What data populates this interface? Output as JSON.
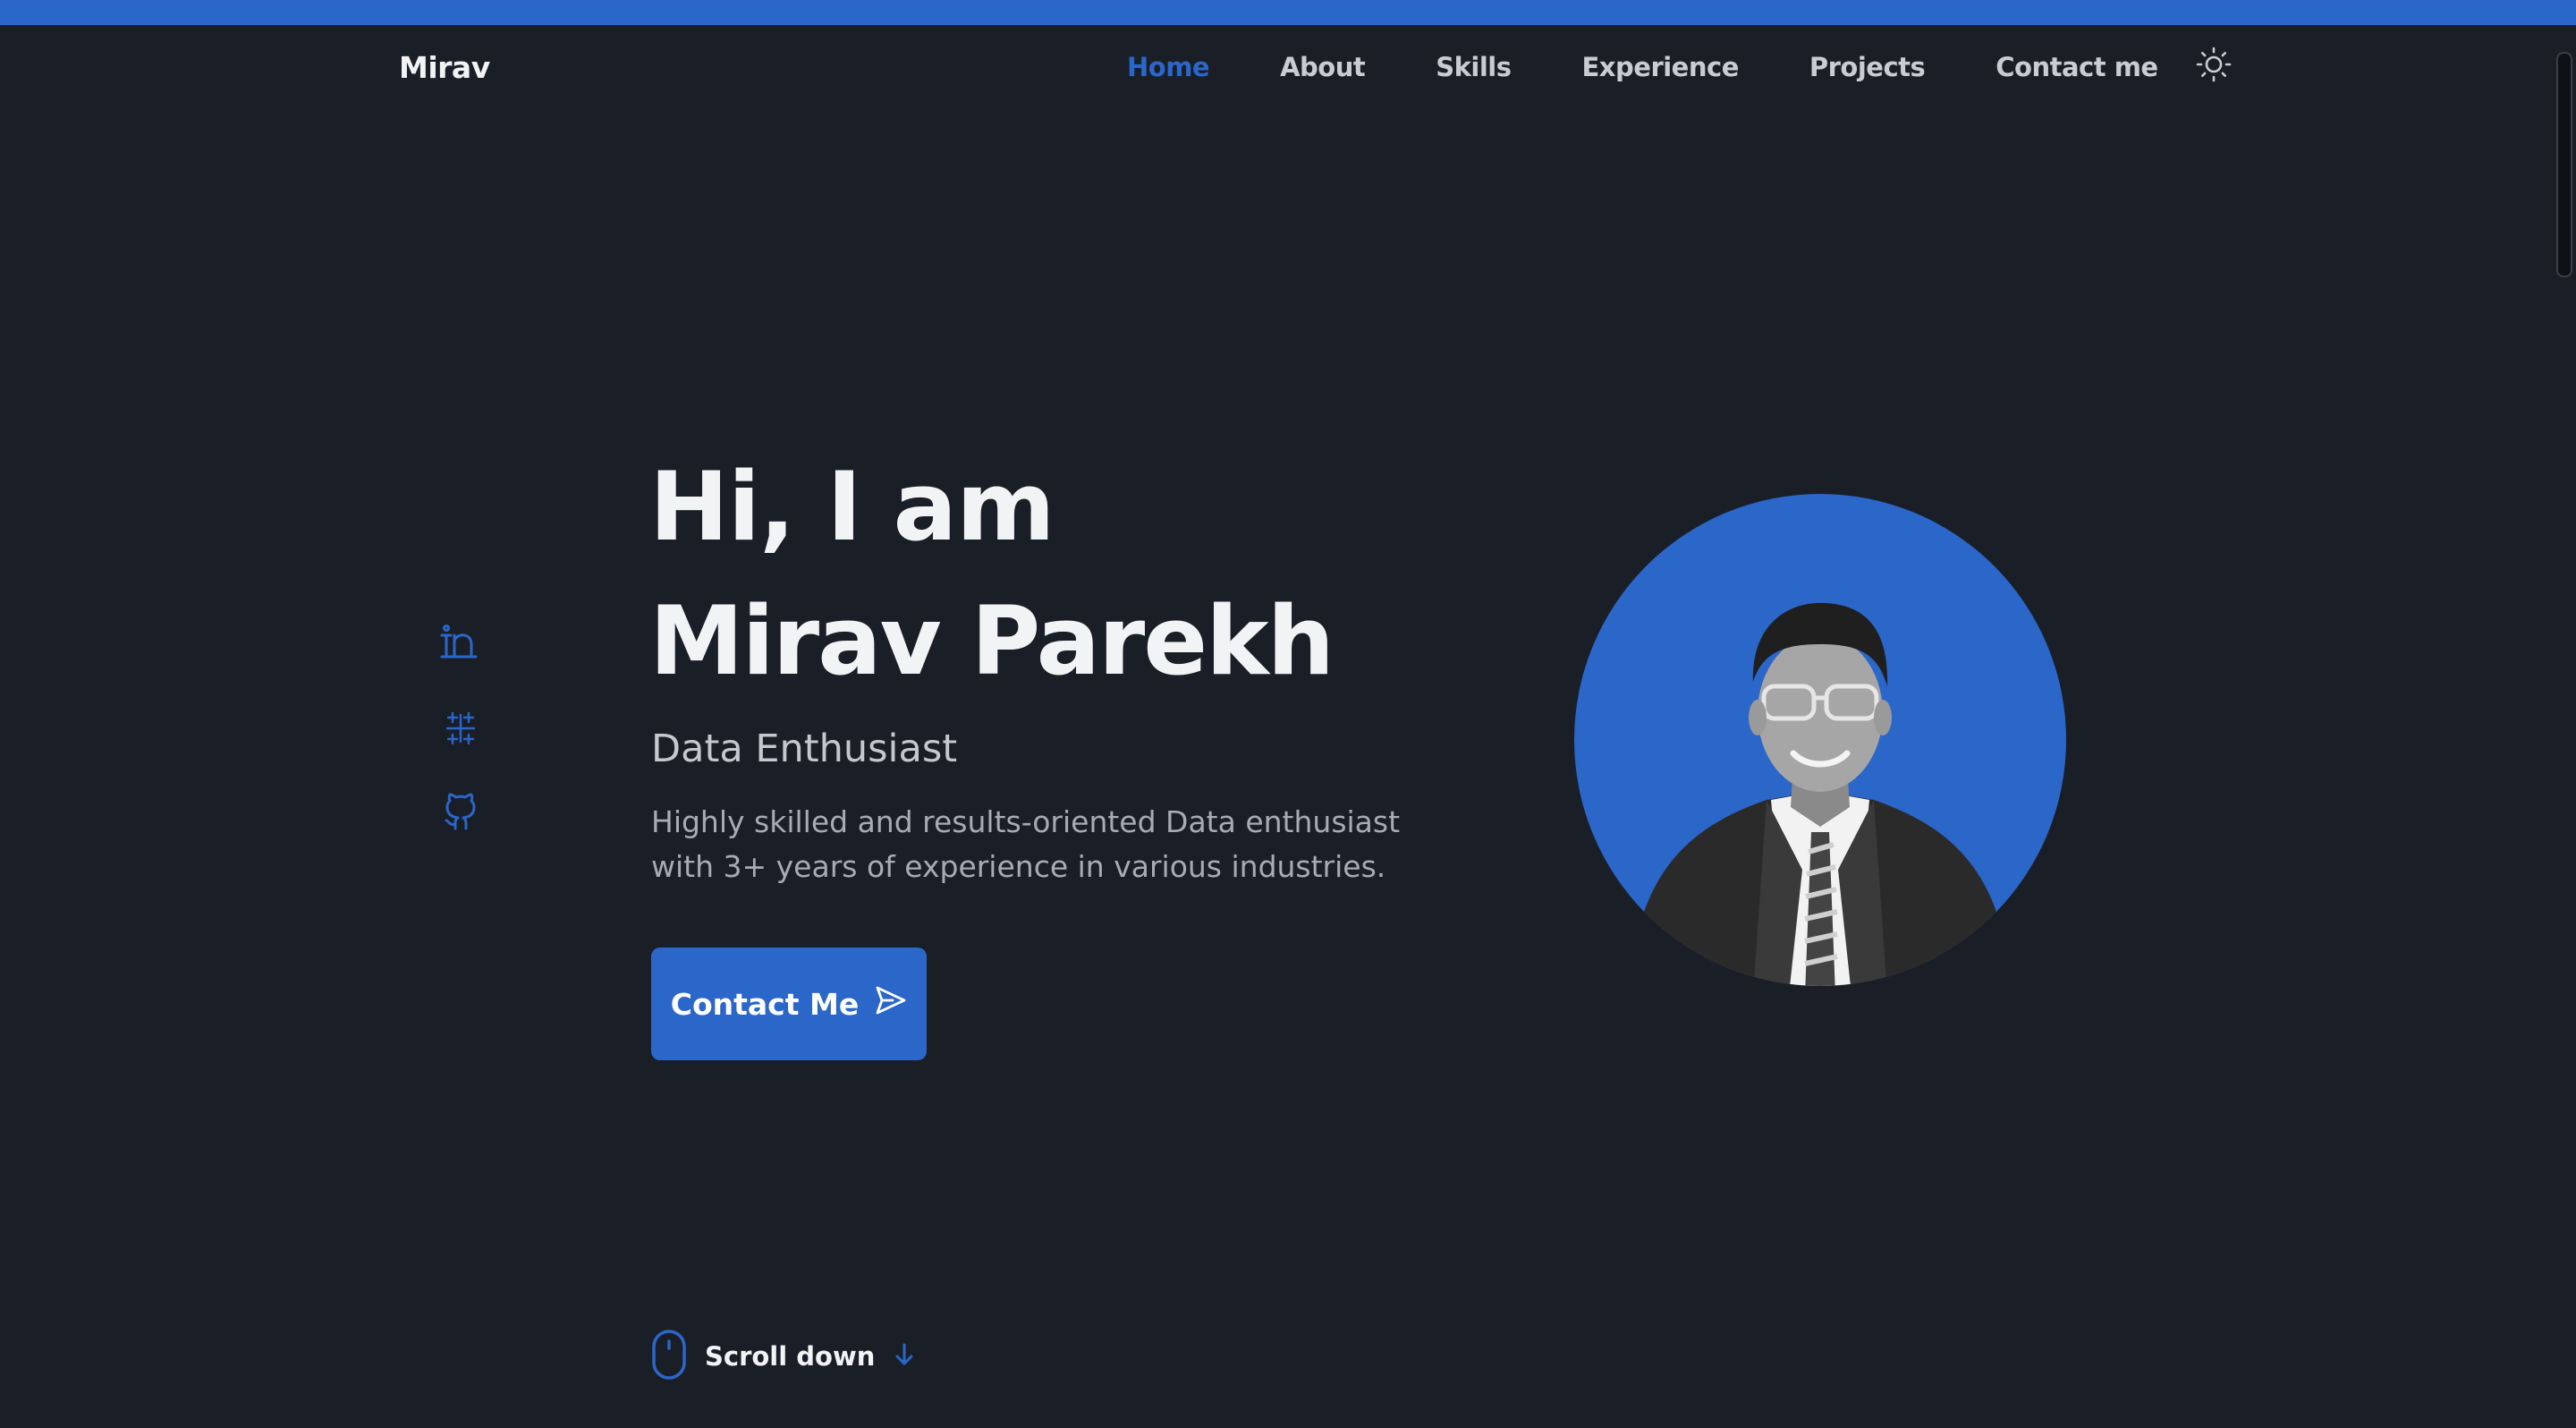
{
  "brand": "Mirav",
  "nav": {
    "items": [
      {
        "label": "Home",
        "active": true
      },
      {
        "label": "About",
        "active": false
      },
      {
        "label": "Skills",
        "active": false
      },
      {
        "label": "Experience",
        "active": false
      },
      {
        "label": "Projects",
        "active": false
      },
      {
        "label": "Contact me",
        "active": false
      }
    ],
    "theme_icon": "sun-icon"
  },
  "social": {
    "icons": [
      "linkedin-icon",
      "tableau-icon",
      "github-icon"
    ]
  },
  "hero": {
    "greeting": "Hi, I am",
    "name": "Mirav Parekh",
    "role": "Data Enthusiast",
    "description": "Highly skilled and results-oriented Data enthusiast with 3+ years of experience in various industries.",
    "cta_label": "Contact Me",
    "cta_icon": "send-icon"
  },
  "scroll": {
    "label": "Scroll down",
    "icons": [
      "mouse-icon",
      "arrow-down-icon"
    ]
  },
  "colors": {
    "background": "#1a1f27",
    "accent": "#2b66c9",
    "text": "#f2f3f5",
    "muted": "#a6abb4"
  }
}
